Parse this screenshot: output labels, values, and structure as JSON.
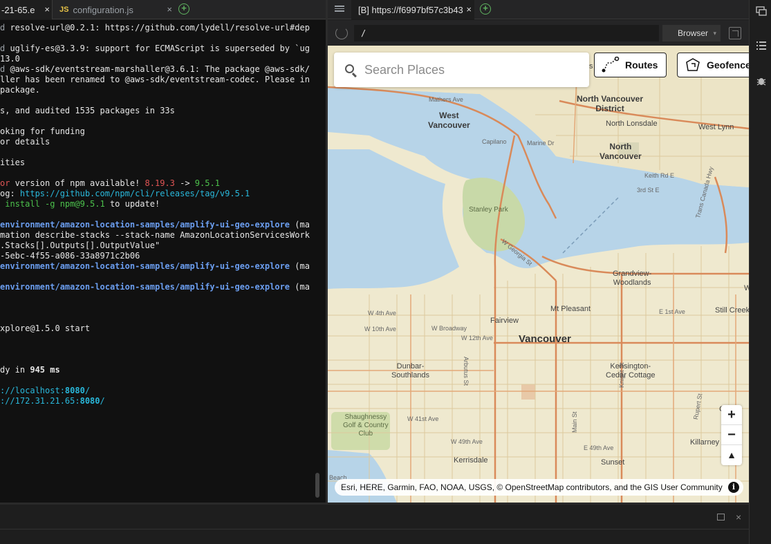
{
  "left_tabs": [
    {
      "label": "-21-65.e",
      "close": "×"
    },
    {
      "label": "configuration.js",
      "badge": "JS",
      "close": "×"
    }
  ],
  "terminal_lines": [
    [
      {
        "t": "d ",
        "c": "c-muted"
      },
      {
        "t": "resolve-url@0.2.1: https://github.com/lydell/resolve-url#dep"
      }
    ],
    [],
    [
      {
        "t": "d ",
        "c": "c-muted"
      },
      {
        "t": "uglify-es@3.3.9: support for ECMAScript is superseded by `ug"
      }
    ],
    [
      {
        "t": "13.0"
      }
    ],
    [
      {
        "t": "d ",
        "c": "c-muted"
      },
      {
        "t": "@aws-sdk/eventstream-marshaller@3.6.1: The package @aws-sdk/"
      }
    ],
    [
      {
        "t": "ller has been renamed to @aws-sdk/eventstream-codec. Please in"
      }
    ],
    [
      {
        "t": "package."
      }
    ],
    [],
    [
      {
        "t": "s, and audited 1535 packages in 33s"
      }
    ],
    [],
    [
      {
        "t": "oking for funding"
      }
    ],
    [
      {
        "t": "or details"
      }
    ],
    [],
    [
      {
        "t": "ities"
      }
    ],
    [],
    [
      {
        "t": "or",
        "c": "c-red"
      },
      {
        "t": " version of npm available! "
      },
      {
        "t": "8.19.3",
        "c": "c-red"
      },
      {
        "t": " -> "
      },
      {
        "t": "9.5.1",
        "c": "c-green"
      }
    ],
    [
      {
        "t": "og: "
      },
      {
        "t": "https://github.com/npm/cli/releases/tag/v9.5.1",
        "c": "c-cyan"
      }
    ],
    [
      {
        "t": " install -g npm@9.5.1",
        "c": "c-green"
      },
      {
        "t": " to update!"
      }
    ],
    [],
    [
      {
        "t": "environment/amazon-location-samples/amplify-ui-geo-explore",
        "c": "c-blue"
      },
      {
        "t": " (ma"
      }
    ],
    [
      {
        "t": "mation describe-stacks --stack-name AmazonLocationServicesWork"
      }
    ],
    [
      {
        "t": ".Stacks[].Outputs[].OutputValue\""
      }
    ],
    [
      {
        "t": "-5ebc-4f55-a086-33a8971c2b06"
      }
    ],
    [
      {
        "t": "environment/amazon-location-samples/amplify-ui-geo-explore",
        "c": "c-blue"
      },
      {
        "t": " (ma"
      }
    ],
    [],
    [
      {
        "t": "environment/amazon-location-samples/amplify-ui-geo-explore",
        "c": "c-blue"
      },
      {
        "t": " (ma"
      }
    ],
    [],
    [],
    [],
    [
      {
        "t": "xplore@1.5.0 start"
      }
    ],
    [],
    [],
    [],
    [
      {
        "t": "dy in "
      },
      {
        "t": "945 ms",
        "c": "c-bold"
      }
    ],
    [],
    [
      {
        "t": "://localhost:",
        "c": "c-cyan"
      },
      {
        "t": "8080",
        "c": "c-cyanb"
      },
      {
        "t": "/",
        "c": "c-cyan"
      }
    ],
    [
      {
        "t": "://172.31.21.65:",
        "c": "c-cyan"
      },
      {
        "t": "8080",
        "c": "c-cyanb"
      },
      {
        "t": "/",
        "c": "c-cyan"
      }
    ]
  ],
  "browser": {
    "tab_label": "[B] https://f6997bf57c3b43",
    "tab_close": "×",
    "address": "/",
    "mode": "Browser"
  },
  "map": {
    "search_placeholder": "Search Places",
    "routes_label": "Routes",
    "geofence_label": "Geofence",
    "zoom_in": "+",
    "zoom_out": "−",
    "reset_north": "▲",
    "attribution": "Esri, HERE, Garmin, FAO, NOAA, USGS, © OpenStreetMap contributors, and the GIS User Community",
    "info": "i",
    "labels": {
      "west_vancouver": "West\nVancouver",
      "north_vancouver_district": "North Vancouver\nDistrict",
      "north_lonsdale": "North Lonsdale",
      "west_lynn": "West Lynn",
      "north_vancouver": "North\nVancouver",
      "mathers_ave": "Mathers Ave",
      "capilano": "Capilano",
      "marine_dr": "Marine Dr",
      "keith_rd": "Keith Rd E",
      "third_st": "3rd St E",
      "trans_canada": "Trans Canada Hwy",
      "stanley_park": "Stanley Park",
      "w_georgia": "W Georgia St",
      "grandview": "Grandview-\nWoodlands",
      "w_4th": "W 4th Ave",
      "w_10th": "W 10th Ave",
      "w_broadway": "W Broadway",
      "w_12th": "W 12th Ave",
      "fairview": "Fairview",
      "mt_pleasant": "Mt Pleasant",
      "e_1st": "E 1st Ave",
      "still_creek": "Still Creek",
      "vancouver": "Vancouver",
      "dunbar": "Dunbar-\nSouthlands",
      "kensington": "Kensington-\nCedar Cottage",
      "arbutus": "Arbutus St",
      "knight": "Knight St",
      "shaughnessy": "Shaughnessy\nGolf & Country\nClub",
      "w_41st": "W 41st Ave",
      "w_49th": "W 49th Ave",
      "e_49th": "E 49th Ave",
      "kerrisdale": "Kerrisdale",
      "sunset": "Sunset",
      "killarney": "Killarney",
      "beach": "Beach",
      "rupert": "Rupert St",
      "main": "Main St",
      "s": "s",
      "w": "W",
      "collingwood": "C"
    }
  }
}
